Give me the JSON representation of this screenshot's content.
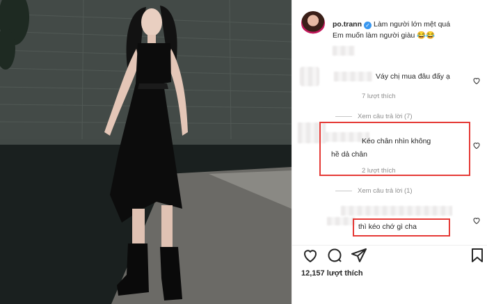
{
  "post": {
    "username": "po.trann",
    "caption_line1": "Làm người lớn mệt quá",
    "caption_line2": "Em muốn làm người giàu 😂😂",
    "likes": "12,157 lượt thích"
  },
  "comments": [
    {
      "text": "Váy chị mua đâu đấy ạ",
      "likes": "7 lượt thích",
      "replies": "Xem câu trả lời (7)"
    },
    {
      "text_line1": "Kéo chân nhìn không",
      "text_line2": "hề dả chân",
      "likes": "2 lượt thích",
      "replies": "Xem câu trả lời (1)"
    },
    {
      "text": "thì kéo chớ gì cha"
    }
  ],
  "colors": {
    "highlight": "#e53935",
    "verified": "#3897f0",
    "text": "#262626",
    "muted": "#8e8e8e"
  },
  "icons": [
    "verified-icon",
    "heart-icon",
    "comment-icon",
    "share-icon",
    "bookmark-icon"
  ]
}
